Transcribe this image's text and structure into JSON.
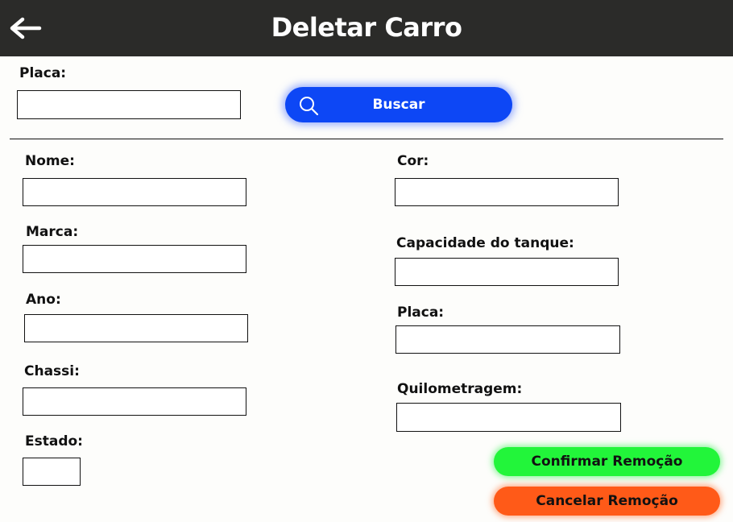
{
  "header": {
    "title": "Deletar Carro",
    "back_icon": "arrow-left-icon"
  },
  "search": {
    "placa_label": "Placa:",
    "placa_value": "",
    "button_label": "Buscar",
    "button_icon": "search-icon",
    "button_color": "#0d47f5"
  },
  "form": {
    "left": {
      "nome": {
        "label": "Nome:",
        "value": ""
      },
      "marca": {
        "label": "Marca:",
        "value": ""
      },
      "ano": {
        "label": "Ano:",
        "value": ""
      },
      "chassi": {
        "label": "Chassi:",
        "value": ""
      },
      "estado": {
        "label": "Estado:",
        "value": ""
      }
    },
    "right": {
      "cor": {
        "label": "Cor:",
        "value": ""
      },
      "capacidade": {
        "label": "Capacidade do tanque:",
        "value": ""
      },
      "placa": {
        "label": "Placa:",
        "value": ""
      },
      "quilometragem": {
        "label": "Quilometragem:",
        "value": ""
      }
    }
  },
  "actions": {
    "confirm_label": "Confirmar Remoção",
    "confirm_color": "#22f53a",
    "cancel_label": "Cancelar Remoção",
    "cancel_color": "#ff5a18"
  }
}
